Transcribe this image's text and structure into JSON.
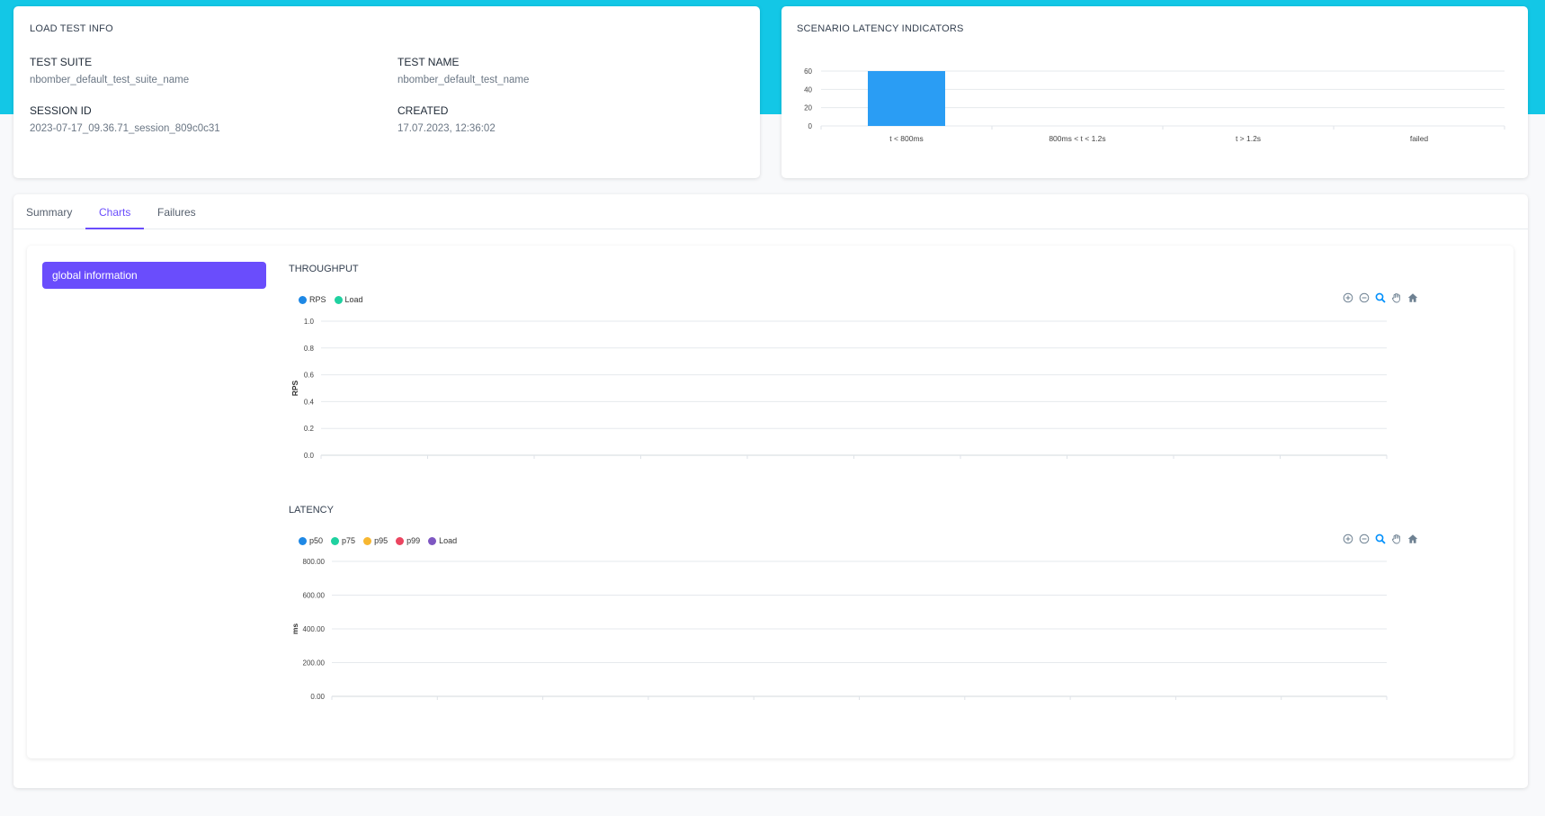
{
  "load_test_info": {
    "title": "LOAD TEST INFO",
    "test_suite_label": "TEST SUITE",
    "test_suite_value": "nbomber_default_test_suite_name",
    "test_name_label": "TEST NAME",
    "test_name_value": "nbomber_default_test_name",
    "session_id_label": "SESSION ID",
    "session_id_value": "2023-07-17_09.36.71_session_809c0c31",
    "created_label": "CREATED",
    "created_value": "17.07.2023, 12:36:02"
  },
  "latency_indicators": {
    "title": "SCENARIO LATENCY INDICATORS",
    "chart_data": {
      "type": "bar",
      "categories": [
        "t < 800ms",
        "800ms < t < 1.2s",
        "t > 1.2s",
        "failed"
      ],
      "values": [
        60,
        0,
        0,
        0
      ],
      "yticks": [
        "60",
        "40",
        "20",
        "0"
      ],
      "ylim": [
        0,
        60
      ],
      "color": "#2a9df4"
    }
  },
  "tabs": [
    {
      "label": "Summary",
      "active": false
    },
    {
      "label": "Charts",
      "active": true
    },
    {
      "label": "Failures",
      "active": false
    }
  ],
  "sidebar": {
    "items": [
      {
        "label": "global information",
        "active": true
      }
    ]
  },
  "throughput": {
    "title": "THROUGHPUT",
    "chart_data": {
      "type": "line",
      "ylabel": "RPS",
      "yticks": [
        "1.0",
        "0.8",
        "0.6",
        "0.4",
        "0.2",
        "0.0"
      ],
      "ylim": [
        0,
        1
      ],
      "series": [
        {
          "name": "RPS",
          "color": "#1e88e5",
          "values": []
        },
        {
          "name": "Load",
          "color": "#1fd1a0",
          "values": []
        }
      ]
    }
  },
  "latency": {
    "title": "LATENCY",
    "chart_data": {
      "type": "line",
      "ylabel": "ms",
      "yticks": [
        "800.00",
        "600.00",
        "400.00",
        "200.00",
        "0.00"
      ],
      "ylim": [
        0,
        800
      ],
      "series": [
        {
          "name": "p50",
          "color": "#1e88e5",
          "values": []
        },
        {
          "name": "p75",
          "color": "#1fd1a0",
          "values": []
        },
        {
          "name": "p95",
          "color": "#f7b731",
          "values": []
        },
        {
          "name": "p99",
          "color": "#eb4560",
          "values": []
        },
        {
          "name": "Load",
          "color": "#7e57c2",
          "values": []
        }
      ]
    }
  },
  "toolbar_icons": [
    "zoom-in-icon",
    "zoom-out-icon",
    "selection-zoom-icon",
    "pan-hand-icon",
    "home-reset-icon"
  ]
}
